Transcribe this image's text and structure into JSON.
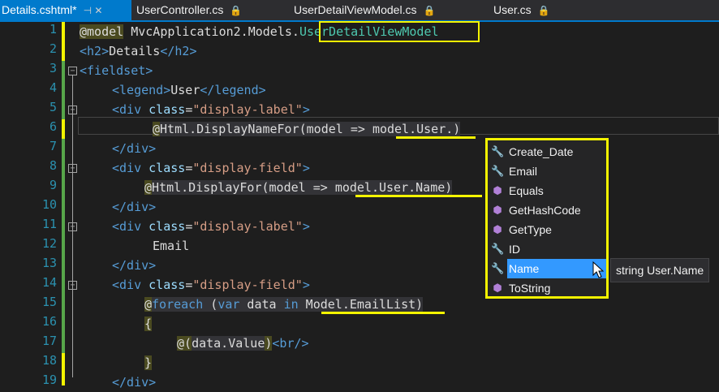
{
  "tabs": [
    {
      "label": "Details.cshtml*",
      "glyph": "⊣ ✕",
      "active": true
    },
    {
      "label": "UserController.cs",
      "glyph": "🔒"
    },
    {
      "label": "UserDetailViewModel.cs",
      "glyph": "🔒"
    },
    {
      "label": "User.cs",
      "glyph": "🔒"
    }
  ],
  "line_numbers": [
    "1",
    "2",
    "3",
    "4",
    "5",
    "6",
    "7",
    "8",
    "9",
    "10",
    "11",
    "12",
    "13",
    "14",
    "15",
    "16",
    "17",
    "18",
    "19"
  ],
  "code": {
    "l1": {
      "a": "@model",
      "b": " MvcApplication2.Models.",
      "c": "UserDetailViewModel"
    },
    "l2": {
      "a": "<h2>",
      "b": "Details",
      "c": "</h2>"
    },
    "l3": {
      "a": "<fieldset>"
    },
    "l4": {
      "a": "<legend>",
      "b": "User",
      "c": "</legend>"
    },
    "l5": {
      "a": "<div",
      "b": " class",
      "c": "=",
      "d": "\"display-label\"",
      "e": ">"
    },
    "l6": {
      "a": "@",
      "b": "Html.DisplayNameFor(model => ",
      "c": "model.User.",
      "d": ")"
    },
    "l7": {
      "a": "</div>"
    },
    "l8": {
      "a": "<div",
      "b": " class",
      "c": "=",
      "d": "\"display-field\"",
      "e": ">"
    },
    "l9": {
      "a": "@",
      "b": "Html.DisplayFor(model => ",
      "c": "model.User.Name",
      "d": ")"
    },
    "l10": {
      "a": "</div>"
    },
    "l11": {
      "a": "<div",
      "b": " class",
      "c": "=",
      "d": "\"display-label\"",
      "e": ">"
    },
    "l12": {
      "a": "Email"
    },
    "l13": {
      "a": "</div>"
    },
    "l14": {
      "a": "<div",
      "b": " class",
      "c": "=",
      "d": "\"display-field\"",
      "e": ">"
    },
    "l15": {
      "a": "@",
      "b": "foreach",
      "c": " (",
      "d": "var",
      "e": " data ",
      "f": "in",
      "g": " Model.EmailList",
      "h": ")"
    },
    "l16": {
      "a": "{"
    },
    "l17": {
      "a": "@(",
      "b": "data.Value",
      "c": ")",
      "d": "<br/>"
    },
    "l18": {
      "a": "}"
    },
    "l19": {
      "a": "</div>"
    }
  },
  "intellisense": {
    "items": [
      {
        "label": "Create_Date",
        "icon": "wrench-icon"
      },
      {
        "label": "Email",
        "icon": "wrench-icon"
      },
      {
        "label": "Equals",
        "icon": "cube-icon"
      },
      {
        "label": "GetHashCode",
        "icon": "cube-icon"
      },
      {
        "label": "GetType",
        "icon": "cube-icon"
      },
      {
        "label": "ID",
        "icon": "wrench-icon"
      },
      {
        "label": "Name",
        "icon": "wrench-icon",
        "selected": true
      },
      {
        "label": "ToString",
        "icon": "cube-icon"
      }
    ],
    "tooltip": "string User.Name"
  },
  "colors": {
    "accent": "#007acc",
    "highlight": "#f4f400",
    "selection": "#3399ff"
  }
}
